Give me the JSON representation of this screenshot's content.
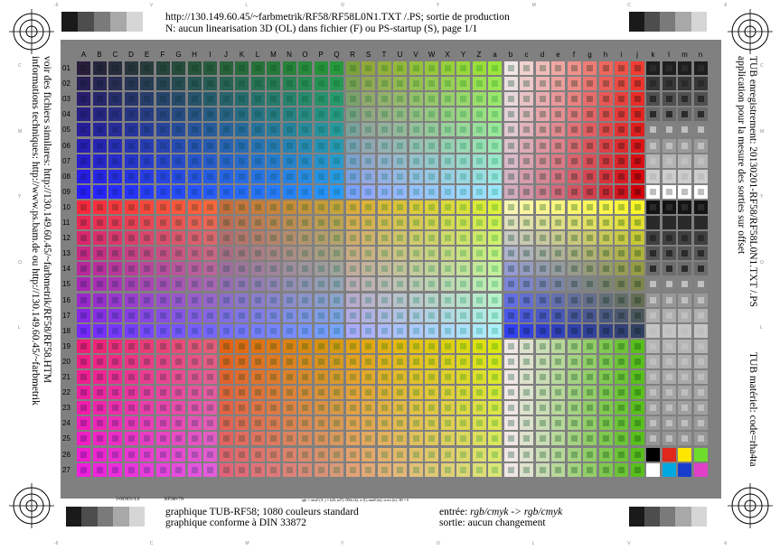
{
  "header": {
    "line1": "http://130.149.60.45/~farbmetrik/RF58/RF58L0N1.TXT /.PS; sortie de production",
    "line2": "N: aucun linearisation 3D (OL) dans fichier (F) ou PS-startup (S), page 1/1"
  },
  "left_vertical": {
    "line1": "voir des fichiers similares: http://130.149.60.45/~farbmetrik/RF58/RF58.HTM",
    "line2": "informations techniques: http://www.ps.bam.de ou http://130.149.60.45/~farbmetrik"
  },
  "right_vertical": {
    "line1": "TUB enregistrement: 20130201-RF58/RF58L0N1.TXT /.PS",
    "line2": "application pour la mesure des sorties sur offset",
    "line3": "TUB matériel: code=rha4ta"
  },
  "footer": {
    "code_left": "3-003031-L0",
    "code_mid": "RF580-7N",
    "tiny_note": "rgb + cmy0 (A, j = k26, n27), 000n (k), w (l), nnn0 (m), www (n), 3D = 0",
    "line1": "graphique TUB-RF58; 1080 couleurs standard",
    "line2": "graphique conforme à DIN 33872",
    "input_prefix": "entrée: ",
    "input_value": "rgb/cmyk -> rgb/cmyk",
    "output_label": "sortie: aucun changement"
  },
  "edge_marks": {
    "top": [
      "-6",
      "V",
      "L",
      "O",
      "Y",
      "M",
      "C",
      "-6"
    ],
    "bottom": [
      "-6",
      "C",
      "M",
      "Y",
      "O",
      "L",
      "V",
      "-6"
    ],
    "left": [
      "C",
      "M",
      "Y",
      "O",
      "L"
    ],
    "right": [
      "C",
      "M",
      "Y",
      "O",
      "L"
    ]
  },
  "gray_strip_colors": [
    "#1a1a1a",
    "#4d4d4d",
    "#7a7a7a",
    "#a8a8a8",
    "#d6d6d6",
    "#ffffff"
  ],
  "gray_strip_colors_rev": [
    "#1a1a1a",
    "#4d4d4d",
    "#7a7a7a",
    "#a8a8a8",
    "#d6d6d6",
    "#ffffff"
  ],
  "columns": [
    "A",
    "B",
    "C",
    "D",
    "E",
    "F",
    "G",
    "H",
    "I",
    "J",
    "K",
    "L",
    "M",
    "N",
    "O",
    "P",
    "Q",
    "R",
    "S",
    "T",
    "U",
    "V",
    "W",
    "X",
    "Y",
    "Z",
    "a",
    "b",
    "c",
    "d",
    "e",
    "f",
    "g",
    "h",
    "i",
    "j",
    "k",
    "l",
    "m",
    "n"
  ],
  "rows": [
    "01",
    "02",
    "03",
    "04",
    "05",
    "06",
    "07",
    "08",
    "09",
    "10",
    "11",
    "12",
    "13",
    "14",
    "15",
    "16",
    "17",
    "18",
    "19",
    "20",
    "21",
    "22",
    "23",
    "24",
    "25",
    "26",
    "27"
  ]
}
